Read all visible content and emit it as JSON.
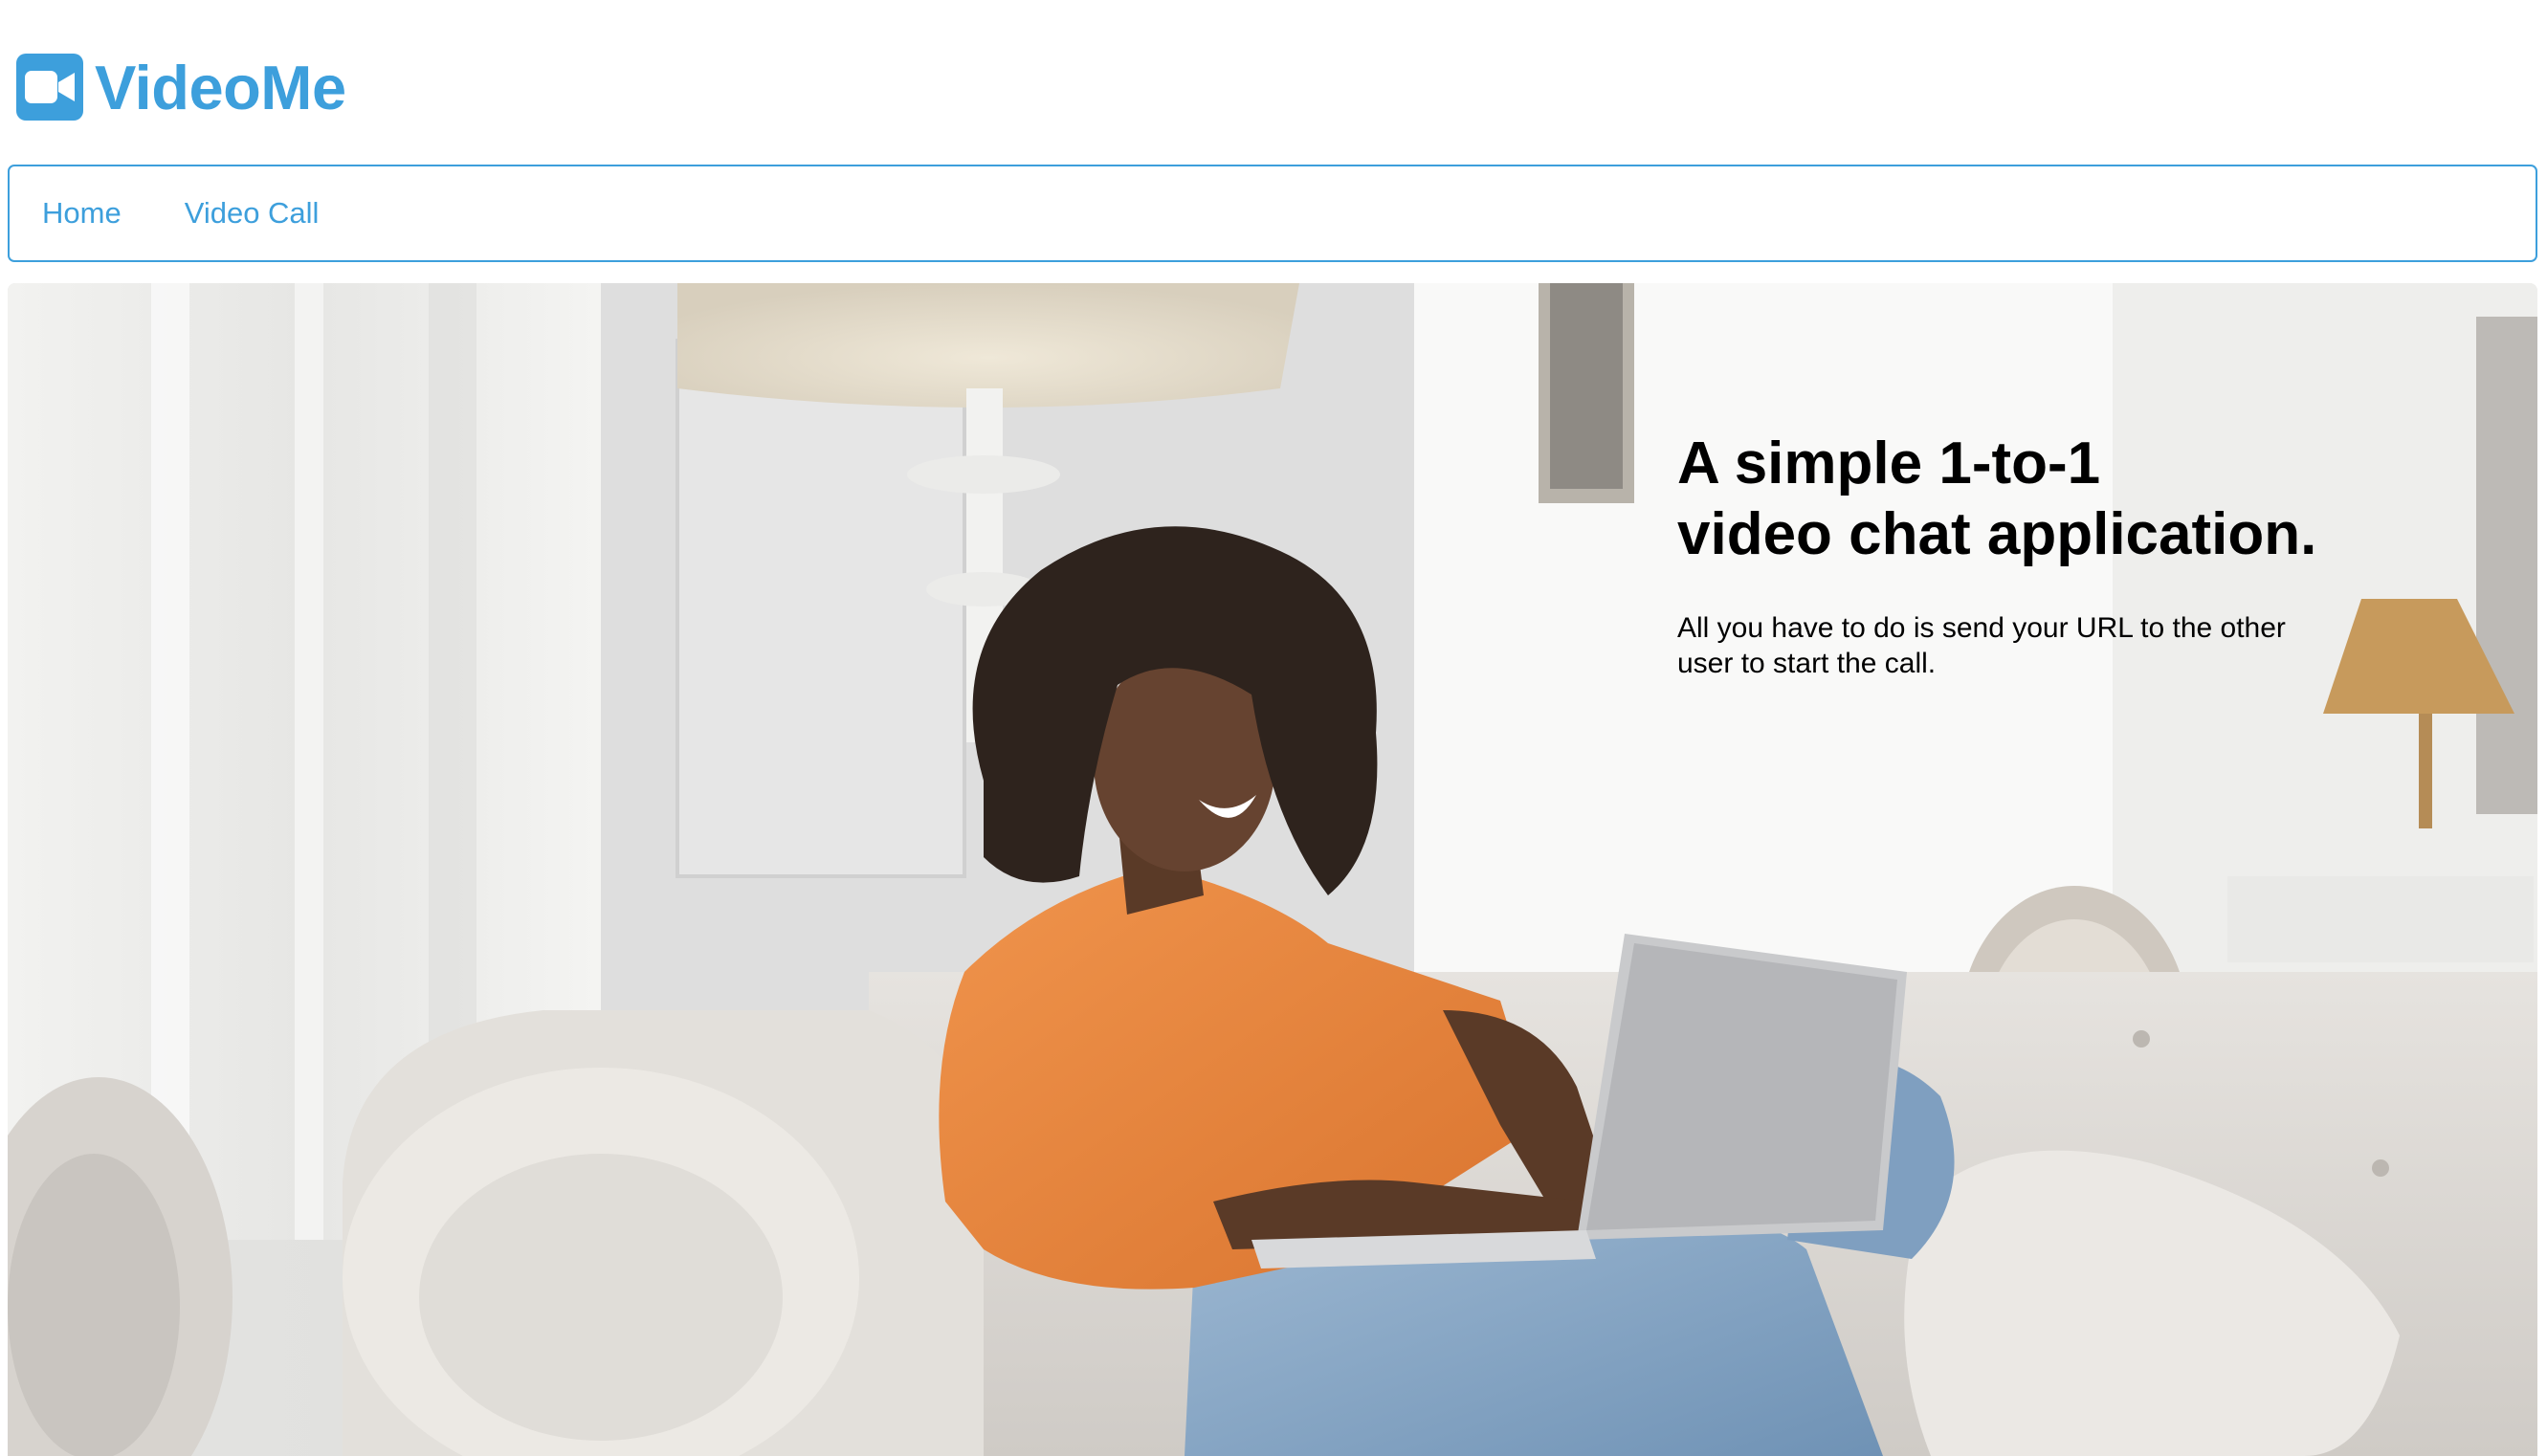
{
  "brand": {
    "name": "VideoMe",
    "icon": "video-camera-icon",
    "color": "#3d9fdc"
  },
  "nav": {
    "items": [
      {
        "label": "Home"
      },
      {
        "label": "Video Call"
      }
    ]
  },
  "hero": {
    "title": "A simple 1-to-1\nvideo chat application.",
    "subtitle": "All you have to do is send your URL to the other user to start the call."
  }
}
